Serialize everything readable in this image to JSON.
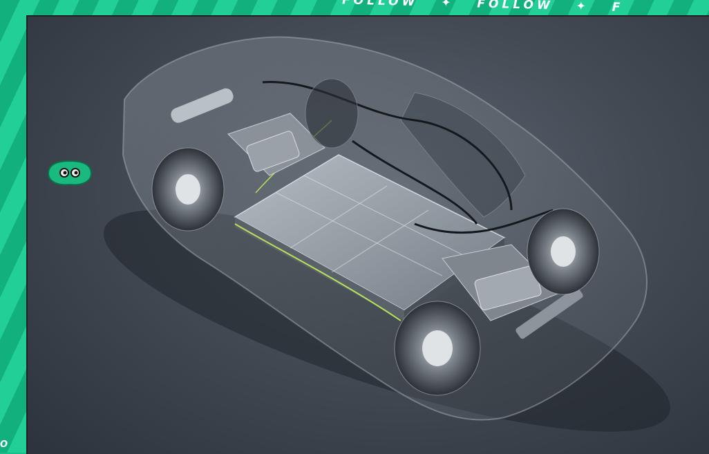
{
  "banner": {
    "words": [
      "FOLLOW",
      "FOLLOW",
      "F"
    ],
    "corner": "O"
  },
  "photo": {
    "subject": "car-chassis-cutaway-icon",
    "colors": {
      "background_dark": "#2d333b",
      "background_light": "#5d6570",
      "frame_green": "#17c08a",
      "wire_green": "#b7e35a",
      "battery_pack": "#9aa3ab"
    }
  },
  "badge": {
    "icon": "eyes-icon",
    "color": "#19b97f"
  }
}
